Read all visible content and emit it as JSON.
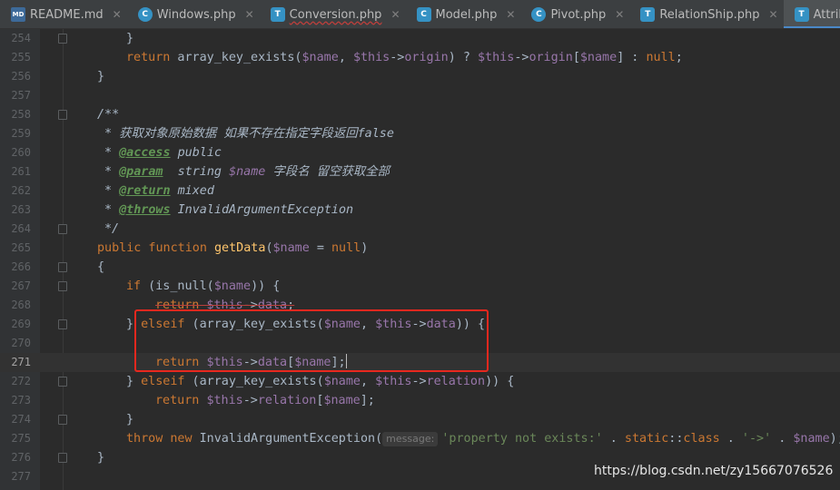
{
  "tabs": [
    {
      "label": "README.md",
      "icon": "markdown-file-icon",
      "icon_text": "MD"
    },
    {
      "label": "Windows.php",
      "icon": "php-class-icon",
      "icon_text": "C"
    },
    {
      "label": "Conversion.php",
      "icon": "php-trait-icon",
      "icon_text": "T"
    },
    {
      "label": "Model.php",
      "icon": "php-trait-icon",
      "icon_text": "C"
    },
    {
      "label": "Pivot.php",
      "icon": "php-class-icon",
      "icon_text": "C"
    },
    {
      "label": "RelationShip.php",
      "icon": "php-trait-icon",
      "icon_text": "T"
    },
    {
      "label": "Attribute.php",
      "icon": "php-trait-icon",
      "icon_text": "T",
      "active": true
    },
    {
      "label": "R",
      "icon": "php-class-icon",
      "icon_text": "C"
    }
  ],
  "editor": {
    "current_line": "271",
    "lines": [
      {
        "n": "254",
        "code": "}"
      },
      {
        "n": "255",
        "code": "return array_key_exists($name, $this->origin) ? $this->origin[$name] : null;"
      },
      {
        "n": "256",
        "code": "}"
      },
      {
        "n": "257",
        "code": ""
      },
      {
        "n": "258",
        "code": "/**"
      },
      {
        "n": "259",
        "code": "* 获取对象原始数据 如果不存在指定字段返回false"
      },
      {
        "n": "260",
        "code": "* @access public"
      },
      {
        "n": "261",
        "code": "* @param  string $name 字段名 留空获取全部"
      },
      {
        "n": "262",
        "code": "* @return mixed"
      },
      {
        "n": "263",
        "code": "* @throws InvalidArgumentException"
      },
      {
        "n": "264",
        "code": "*/"
      },
      {
        "n": "265",
        "code": "public function getData($name = null)"
      },
      {
        "n": "266",
        "code": "{"
      },
      {
        "n": "267",
        "code": "if (is_null($name)) {"
      },
      {
        "n": "268",
        "code": "return $this->data;"
      },
      {
        "n": "269",
        "code": "} elseif (array_key_exists($name, $this->data)) {"
      },
      {
        "n": "270",
        "code": ""
      },
      {
        "n": "271",
        "code": "return $this->data[$name];"
      },
      {
        "n": "272",
        "code": "} elseif (array_key_exists($name, $this->relation)) {"
      },
      {
        "n": "273",
        "code": "return $this->relation[$name];"
      },
      {
        "n": "274",
        "code": "}"
      },
      {
        "n": "275",
        "code": "throw new InvalidArgumentException(message: 'property not exists:' . static::class . '->' . $name);"
      },
      {
        "n": "276",
        "code": "}"
      },
      {
        "n": "277",
        "code": ""
      }
    ],
    "param_hint": "message:"
  },
  "watermark": "https://blog.csdn.net/zy15667076526",
  "colors": {
    "background": "#2b2b2b",
    "keyword": "#cc7832",
    "variable": "#9876aa",
    "string": "#6a8759",
    "function": "#ffc66d",
    "highlight_box": "#e8281e"
  }
}
